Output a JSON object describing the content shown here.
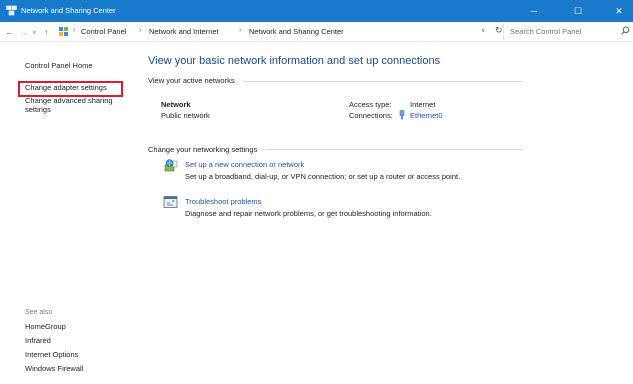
{
  "window": {
    "title": "Network and Sharing Center",
    "controls": {
      "minimize": "─",
      "maximize": "☐",
      "close": "✕"
    }
  },
  "address_bar": {
    "nav": {
      "back": "←",
      "forward": "→",
      "recent": "∨",
      "up": "↑"
    },
    "breadcrumbs": [
      "Control Panel",
      "Network and Internet",
      "Network and Sharing Center"
    ],
    "separator": "›",
    "dropdown": "∨",
    "refresh": "↻",
    "search_placeholder": "Search Control Panel"
  },
  "left_pane": {
    "home": "Control Panel Home",
    "links": [
      "Change adapter settings",
      "Change advanced sharing settings"
    ],
    "see_also_title": "See also",
    "see_also": [
      "HomeGroup",
      "Infrared",
      "Internet Options",
      "Windows Firewall"
    ]
  },
  "main": {
    "heading": "View your basic network information and set up connections",
    "active_networks_label": "View your active networks",
    "network": {
      "name": "Network",
      "type": "Public network",
      "access_type_label": "Access type:",
      "access_type_value": "Internet",
      "connections_label": "Connections:",
      "connections_value": "Ethernet0"
    },
    "change_settings_label": "Change your networking settings",
    "tasks": [
      {
        "icon": "network-setup-icon",
        "title": "Set up a new connection or network",
        "description": "Set up a broadband, dial-up, or VPN connection; or set up a router or access point."
      },
      {
        "icon": "troubleshoot-icon",
        "title": "Troubleshoot problems",
        "description": "Diagnose and repair network problems, or get troubleshooting information."
      }
    ]
  },
  "colors": {
    "titlebar": "#1979ca",
    "heading": "#1a4a8c",
    "link": "#1f56ad",
    "highlight": "#d9202a"
  }
}
